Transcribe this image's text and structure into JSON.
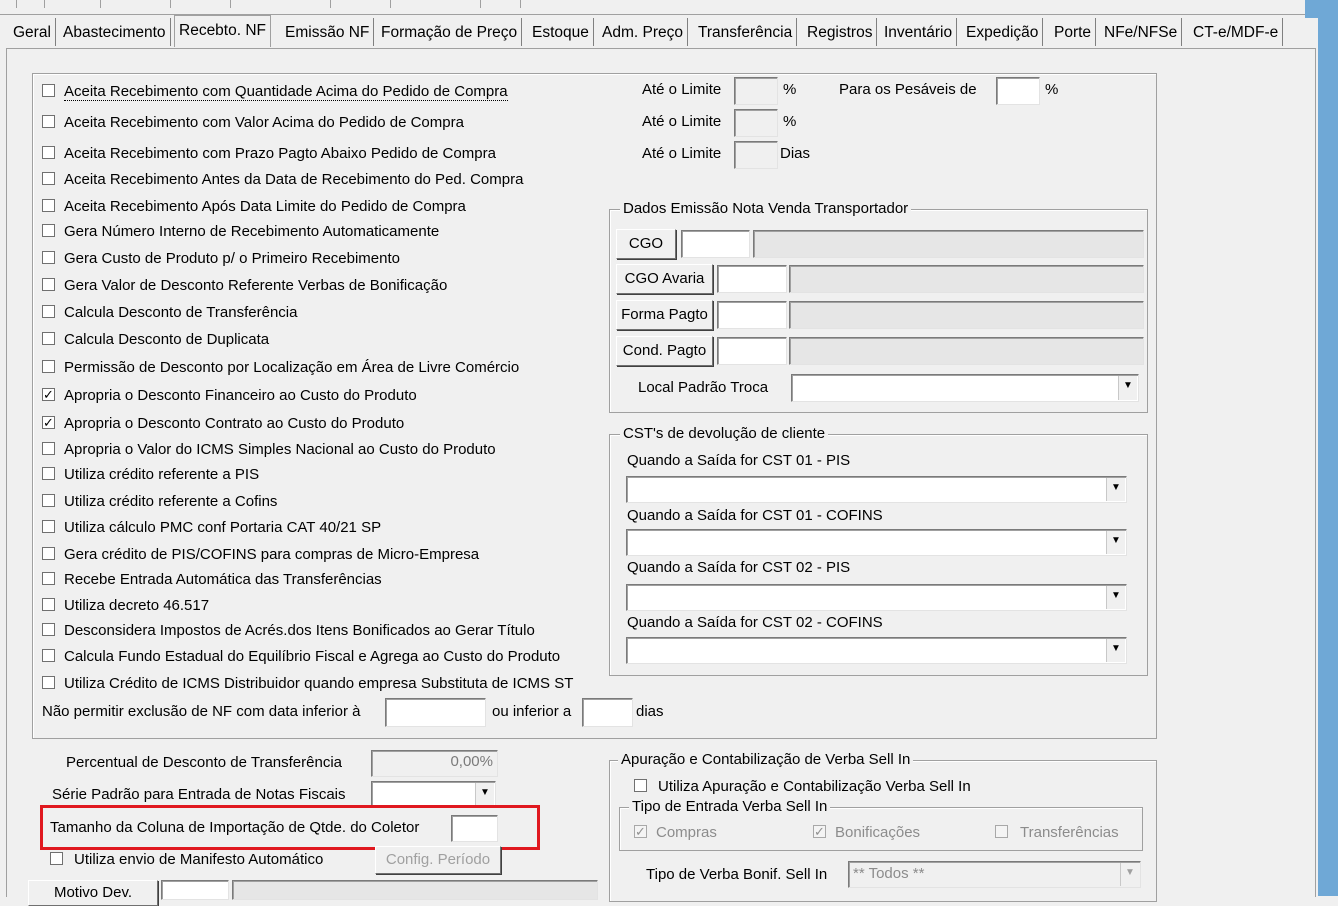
{
  "tabs": [
    "Geral",
    "Abastecimento",
    "Recebto. NF",
    "Emissão NF",
    "Formação de Preço",
    "Estoque",
    "Adm. Preço",
    "Transferência",
    "Registros",
    "Inventário",
    "Expedição",
    "Porte",
    "NFe/NFSe",
    "CT-e/MDF-e"
  ],
  "active_tab": "Recebto. NF",
  "options": [
    {
      "label": "Aceita Recebimento com Quantidade Acima do Pedido de Compra",
      "checked": false
    },
    {
      "label": "Aceita Recebimento com Valor Acima do Pedido de Compra",
      "checked": false
    },
    {
      "label": "Aceita Recebimento com Prazo Pagto Abaixo Pedido de Compra",
      "checked": false
    },
    {
      "label": "Aceita Recebimento Antes da Data de Recebimento do Ped. Compra",
      "checked": false
    },
    {
      "label": "Aceita Recebimento Após Data Limite do Pedido de Compra",
      "checked": false
    },
    {
      "label": "Gera Número Interno de Recebimento Automaticamente",
      "checked": false
    },
    {
      "label": "Gera Custo de Produto p/ o Primeiro Recebimento",
      "checked": false
    },
    {
      "label": "Gera Valor de Desconto Referente Verbas de Bonificação",
      "checked": false
    },
    {
      "label": "Calcula Desconto de Transferência",
      "checked": false
    },
    {
      "label": "Calcula Desconto de Duplicata",
      "checked": false
    },
    {
      "label": "Permissão de Desconto por Localização em Área de Livre Comércio",
      "checked": false
    },
    {
      "label": "Apropria o Desconto Financeiro ao Custo do Produto",
      "checked": true
    },
    {
      "label": "Apropria o Desconto Contrato ao Custo do Produto",
      "checked": true
    },
    {
      "label": "Apropria o Valor do ICMS Simples Nacional ao Custo do Produto",
      "checked": false
    },
    {
      "label": "Utiliza crédito referente a PIS",
      "checked": false
    },
    {
      "label": "Utiliza crédito referente a Cofins",
      "checked": false
    },
    {
      "label": "Utiliza cálculo PMC conf Portaria CAT 40/21 SP",
      "checked": false
    },
    {
      "label": "Gera crédito de PIS/COFINS para compras de Micro-Empresa",
      "checked": false
    },
    {
      "label": "Recebe Entrada Automática das Transferências",
      "checked": false
    },
    {
      "label": "Utiliza decreto 46.517",
      "checked": false
    },
    {
      "label": "Desconsidera Impostos de Acrés.dos Itens Bonificados ao Gerar Título",
      "checked": false
    },
    {
      "label": "Calcula Fundo Estadual do Equilíbrio Fiscal e  Agrega ao Custo do Produto",
      "checked": false
    },
    {
      "label": "Utiliza Crédito de ICMS Distribuidor quando empresa Substituta de ICMS ST",
      "checked": false
    }
  ],
  "limits": {
    "ate_o_limite": "Até o Limite",
    "percent": "%",
    "dias": "Dias",
    "pesaveis": "Para os Pesáveis de"
  },
  "exclusao": {
    "label": "Não permitir exclusão de NF com data inferior à",
    "or_label": "ou inferior a",
    "unit": "dias"
  },
  "transportador": {
    "legend": "Dados Emissão Nota Venda Transportador",
    "cgo": "CGO",
    "cgo_avaria": "CGO Avaria",
    "forma_pagto": "Forma Pagto",
    "cond_pagto": "Cond. Pagto",
    "local_troca": "Local Padrão Troca"
  },
  "cst": {
    "legend": "CST's de devolução de cliente",
    "pis01": "Quando a Saída for CST 01 - PIS",
    "cofins01": "Quando a Saída for CST 01 - COFINS",
    "pis02": "Quando a Saída for CST 02 - PIS",
    "cofins02": "Quando a Saída for CST 02 - COFINS"
  },
  "bottom_left": {
    "perc_desc_label": "Percentual de Desconto de Transferência",
    "perc_desc_value": "0,00%",
    "serie_label": "Série Padrão para Entrada de Notas Fiscais",
    "tamanho_label": "Tamanho da Coluna de Importação de Qtde. do Coletor",
    "manifesto_label": "Utiliza envio de Manifesto Automático",
    "config_periodo": "Config. Período",
    "motivo_dev": "Motivo Dev."
  },
  "sellin": {
    "legend": "Apuração e Contabilização de Verba Sell In",
    "utiliza": "Utiliza Apuração e Contabilização Verba Sell In",
    "tipo_entrada_legend": "Tipo de Entrada Verba Sell In",
    "compras": "Compras",
    "bonificacoes": "Bonificações",
    "transferencias": "Transferências",
    "tipo_verba_label": "Tipo de Verba Bonif. Sell In",
    "tipo_verba_value": "** Todos **"
  },
  "colors": {
    "highlight": "#e0181f",
    "window_border": "#6fa8d6"
  }
}
